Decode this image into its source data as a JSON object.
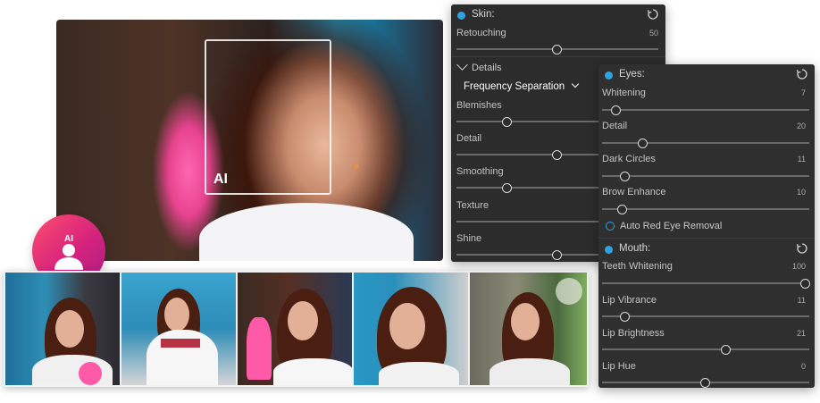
{
  "hero": {
    "ai_label": "AI"
  },
  "avatar": {
    "label": "AI"
  },
  "skin_panel": {
    "title": "Skin:",
    "rows": [
      {
        "label": "Retouching",
        "value": "50",
        "level": 0.5
      }
    ],
    "details_label": "Details",
    "dropdown_label": "Frequency Separation",
    "detail_rows": [
      {
        "label": "Blemishes",
        "level": 0.25
      },
      {
        "label": "Detail",
        "level": 0.5
      },
      {
        "label": "Smoothing",
        "level": 0.25
      },
      {
        "label": "Texture",
        "level": null
      },
      {
        "label": "Shine",
        "level": 0.5
      }
    ]
  },
  "eyes_panel": {
    "title": "Eyes:",
    "rows": [
      {
        "label": "Whitening",
        "value": "7",
        "level": 0.07
      },
      {
        "label": "Detail",
        "value": "20",
        "level": 0.2
      },
      {
        "label": "Dark Circles",
        "value": "11",
        "level": 0.11
      },
      {
        "label": "Brow Enhance",
        "value": "10",
        "level": 0.1
      }
    ],
    "red_eye_label": "Auto Red Eye Removal"
  },
  "mouth_panel": {
    "title": "Mouth:",
    "rows": [
      {
        "label": "Teeth Whitening",
        "value": "100",
        "level": 1.0
      },
      {
        "label": "Lip Vibrance",
        "value": "11",
        "level": 0.11
      },
      {
        "label": "Lip Brightness",
        "value": "21",
        "level": 0.6
      },
      {
        "label": "Lip Hue",
        "value": "0",
        "level": 0.5
      }
    ]
  },
  "colors": {
    "accent": "#2ea3e0",
    "avatar_start": "#ff4e6e",
    "avatar_end": "#a81c83"
  }
}
